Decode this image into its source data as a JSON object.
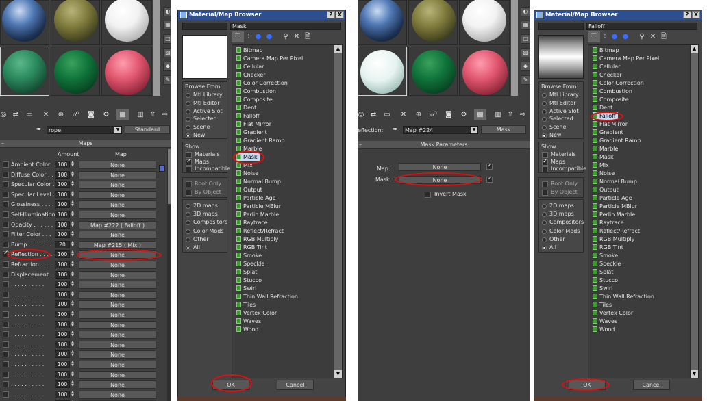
{
  "left_editor": {
    "material_name": "rope",
    "material_type": "Standard",
    "rollout_title": "Maps",
    "col_amount": "Amount",
    "col_map": "Map",
    "rows": [
      {
        "label": "Ambient Color . .",
        "amount": "100",
        "map": "None",
        "checked": false
      },
      {
        "label": "Diffuse Color . .",
        "amount": "100",
        "map": "None",
        "checked": false
      },
      {
        "label": "Specular Color . .",
        "amount": "100",
        "map": "None",
        "checked": false
      },
      {
        "label": "Specular Level . .",
        "amount": "100",
        "map": "None",
        "checked": false
      },
      {
        "label": "Glossiness . . . .",
        "amount": "100",
        "map": "None",
        "checked": false
      },
      {
        "label": "Self-Illumination .",
        "amount": "100",
        "map": "None",
        "checked": false
      },
      {
        "label": "Opacity . . . . . .",
        "amount": "100",
        "map": "Map #222  ( Falloff )",
        "checked": false
      },
      {
        "label": "Filter Color . . .",
        "amount": "100",
        "map": "None",
        "checked": false
      },
      {
        "label": "Bump . . . . . . .",
        "amount": "20",
        "map": "Map #215  ( Mix )",
        "checked": false
      },
      {
        "label": "Reflection . . . .",
        "amount": "100",
        "map": "None",
        "checked": true
      },
      {
        "label": "Refraction . . . .",
        "amount": "100",
        "map": "None",
        "checked": false
      },
      {
        "label": "Displacement . . .",
        "amount": "100",
        "map": "None",
        "checked": false
      },
      {
        "label": ". . . . . . . . . .",
        "amount": "100",
        "map": "None",
        "checked": false
      },
      {
        "label": ". . . . . . . . . .",
        "amount": "100",
        "map": "None",
        "checked": false
      },
      {
        "label": ". . . . . . . . . .",
        "amount": "100",
        "map": "None",
        "checked": false
      },
      {
        "label": ". . . . . . . . . .",
        "amount": "100",
        "map": "None",
        "checked": false
      },
      {
        "label": ". . . . . . . . . .",
        "amount": "100",
        "map": "None",
        "checked": false
      },
      {
        "label": ". . . . . . . . . .",
        "amount": "100",
        "map": "None",
        "checked": false
      },
      {
        "label": ". . . . . . . . . .",
        "amount": "100",
        "map": "None",
        "checked": false
      },
      {
        "label": ". . . . . . . . . .",
        "amount": "100",
        "map": "None",
        "checked": false
      },
      {
        "label": ". . . . . . . . . .",
        "amount": "100",
        "map": "None",
        "checked": false
      },
      {
        "label": ". . . . . . . . . .",
        "amount": "100",
        "map": "None",
        "checked": false
      },
      {
        "label": ". . . . . . . . . .",
        "amount": "100",
        "map": "None",
        "checked": false
      },
      {
        "label": ". . . . . . . . . .",
        "amount": "100",
        "map": "None",
        "checked": false
      },
      {
        "label": ". . . . . . . . . .",
        "amount": "100",
        "map": "None",
        "checked": false
      }
    ]
  },
  "right_editor": {
    "field_label": "eflection:",
    "map_name": "Map #224",
    "map_type": "Mask",
    "rollout_title": "Mask Parameters",
    "map_label": "Map:",
    "map_value": "None",
    "mask_label": "Mask:",
    "mask_value": "None",
    "invert_label": "Invert Mask"
  },
  "browser_left": {
    "title": "Material/Map Browser",
    "help": "?",
    "close": "X",
    "search": "Mask",
    "browse_from_title": "Browse From:",
    "browse_from": [
      "Mtl Library",
      "Mtl Editor",
      "Active Slot",
      "Selected",
      "Scene",
      "New"
    ],
    "show_title": "Show",
    "show": [
      "Materials",
      "Maps",
      "Incompatible"
    ],
    "root_only": "Root Only",
    "by_object": "By Object",
    "categories": [
      "2D maps",
      "3D maps",
      "Compositors",
      "Color Mods",
      "Other",
      "All"
    ],
    "selected_item": "Mask",
    "ok": "OK",
    "cancel": "Cancel"
  },
  "browser_right": {
    "title": "Material/Map Browser",
    "help": "?",
    "close": "X",
    "search": "Falloff",
    "browse_from_title": "Browse From:",
    "browse_from": [
      "Mtl Library",
      "Mtl Editor",
      "Active Slot",
      "Selected",
      "Scene",
      "New"
    ],
    "show_title": "Show",
    "show": [
      "Materials",
      "Maps",
      "Incompatible"
    ],
    "root_only": "Root Only",
    "by_object": "By Object",
    "categories": [
      "2D maps",
      "3D maps",
      "Compositors",
      "Color Mods",
      "Other",
      "All"
    ],
    "selected_item": "Falloff",
    "ok": "OK",
    "cancel": "Cancel"
  },
  "map_types": [
    "Bitmap",
    "Camera Map Per Pixel",
    "Cellular",
    "Checker",
    "Color Correction",
    "Combustion",
    "Composite",
    "Dent",
    "Falloff",
    "Flat Mirror",
    "Gradient",
    "Gradient Ramp",
    "Marble",
    "Mask",
    "Mix",
    "Noise",
    "Normal Bump",
    "Output",
    "Particle Age",
    "Particle MBlur",
    "Perlin Marble",
    "Raytrace",
    "Reflect/Refract",
    "RGB Multiply",
    "RGB Tint",
    "Smoke",
    "Speckle",
    "Splat",
    "Stucco",
    "Swirl",
    "Thin Wall Refraction",
    "Tiles",
    "Vertex Color",
    "Waves",
    "Wood"
  ],
  "colors": {
    "highlight": "#e01010",
    "titlebar": "#2d4f8f",
    "panel": "#444444",
    "map_icon": "#3f9a34"
  }
}
